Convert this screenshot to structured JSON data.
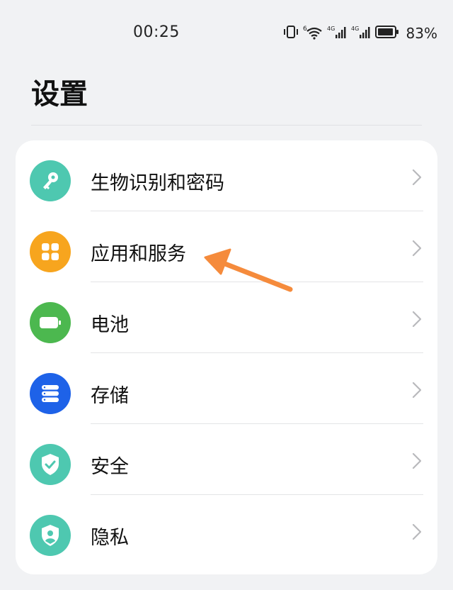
{
  "status_bar": {
    "time": "00:25",
    "battery_percent": "83%",
    "icons": [
      "vibrate-icon",
      "wifi-6-icon",
      "signal-4g-icon",
      "signal-4g-icon",
      "battery-icon"
    ]
  },
  "page": {
    "title": "设置"
  },
  "settings": {
    "items": [
      {
        "label": "生物识别和密码",
        "icon": "key-icon",
        "color": "#4ec8b0"
      },
      {
        "label": "应用和服务",
        "icon": "apps-grid-icon",
        "color": "#f7a51e"
      },
      {
        "label": "电池",
        "icon": "battery-icon",
        "color": "#4cb84f"
      },
      {
        "label": "存储",
        "icon": "storage-icon",
        "color": "#1e62e8"
      },
      {
        "label": "安全",
        "icon": "shield-check-icon",
        "color": "#4ec8b0"
      },
      {
        "label": "隐私",
        "icon": "privacy-shield-icon",
        "color": "#4ec8b0"
      }
    ]
  },
  "annotation": {
    "arrow_color": "#f58b3c"
  }
}
